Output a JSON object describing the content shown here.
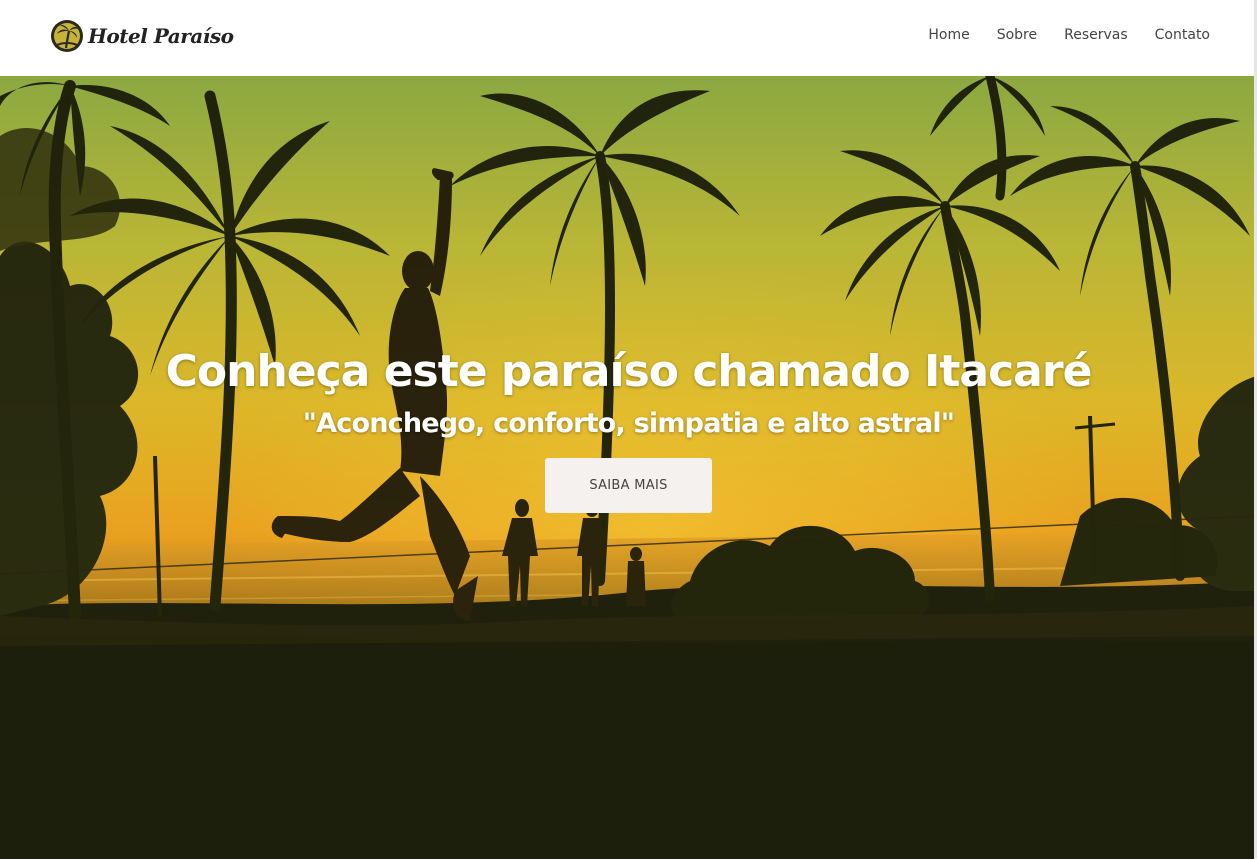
{
  "header": {
    "logo_text": "Hotel Paraíso",
    "nav": [
      {
        "label": "Home"
      },
      {
        "label": "Sobre"
      },
      {
        "label": "Reservas"
      },
      {
        "label": "Contato"
      }
    ]
  },
  "hero": {
    "title": "Conheça este paraíso chamado Itacaré",
    "subtitle": "\"Aconchego, conforto, simpatia e alto astral\"",
    "button_label": "SAIBA MAIS",
    "background_image": "sunset-beach-palm-trees-slackline-photo"
  },
  "colors": {
    "header_bg": "#ffffff",
    "nav_text": "#444444",
    "hero_dark": "#1c1f0b",
    "sky_top": "#a9c64f",
    "sky_mid": "#e3c02c",
    "horizon": "#e58f1a",
    "button_bg": "#f4f1ee"
  }
}
